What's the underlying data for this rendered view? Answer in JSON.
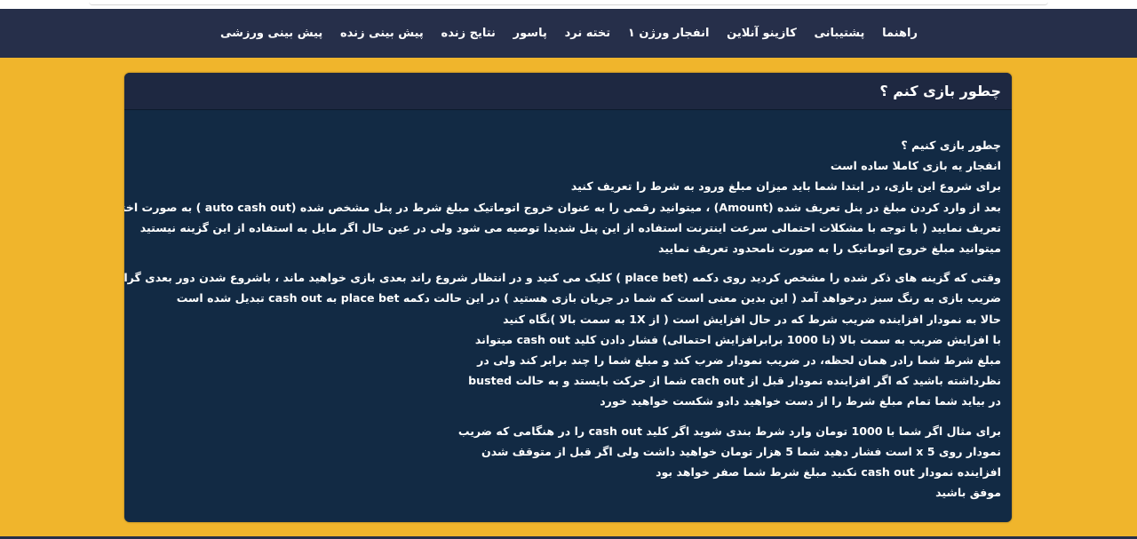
{
  "nav": {
    "items": [
      "پیش بینی ورزشی",
      "پیش بینی زنده",
      "نتایج زنده",
      "پاسور",
      "تخته نرد",
      "انفجار ورژن ۱",
      "کازینو آنلاین",
      "پشتیبانی",
      "راهنما"
    ]
  },
  "panel": {
    "title": "چطور بازی کنم ؟",
    "paragraphs": [
      [
        "چطور بازی کنیم ؟",
        "انفجار یه بازی کاملا ساده است",
        "برای شروع این بازی، در ابتدا شما باید میزان مبلغ ورود به شرط را تعریف کنید",
        "بعد از وارد کردن مبلغ در پنل تعریف شده (Amount) ، میتوانید رقمی را به عنوان خروج اتوماتیک مبلغ شرط در پنل مشخص شده (auto cash out ) به صورت اختیاری",
        "تعریف نمایید ( با توجه با مشکلات احتمالی سرعت اینترنت استفاده از این پنل شدیدا توصیه می شود ولی در عین حال اگر مایل به استفاده از این گزینه نیستید",
        "میتوانید مبلغ خروج اتوماتیک را به صورت نامحدود تعریف نمایید"
      ],
      [
        "وقتی که گزینه های ذکر شده را مشخص کردید روی دکمه (place bet ) کلیک می کنید و در انتظار شروع راند بعدی بازی خواهید ماند ، باشروع شدن دور بعدی گراف",
        "ضریب بازی به رنگ سبز درخواهد آمد ( این بدین معنی است که شما در جریان بازی هستید ) در این حالت دکمه place bet به cash out تبدیل شده است",
        "حالا به نمودار افزاینده ضریب شرط که در حال افزایش است ( از 1X به سمت بالا )نگاه کنید",
        "با افزایش ضریب به سمت بالا (تا 1000 برابرافزایش احتمالی) فشار دادن کلید cash out میتواند",
        "مبلغ شرط شما رادر همان لحظه، در ضریب نمودار ضرب کند و مبلغ شما را چند برابر کند ولی در",
        "نظرداشته باشید که اگر افزاینده نمودار قبل از cach out شما از حرکت بایستد و به حالت busted",
        "در بیاید شما تمام مبلغ شرط را از دست خواهید دادو شکست خواهید خورد"
      ],
      [
        "برای مثال اگر شما با 1000 تومان وارد شرط بندی شوید اگر کلید cash out را در هنگامی که ضریب",
        "نمودار روی 5 x است فشار دهید شما 5 هزار تومان خواهید داشت ولی اگر قبل از متوقف شدن",
        "افزاینده نمودار cash out نکنید مبلغ شرط شما صفر خواهد بود",
        "موفق باشید"
      ]
    ]
  },
  "colors": {
    "page_background": "#f0b52c",
    "navbar": "#262f4a",
    "panel": "#122a44",
    "panel_header": "#1e2841",
    "text": "#ffffff"
  }
}
